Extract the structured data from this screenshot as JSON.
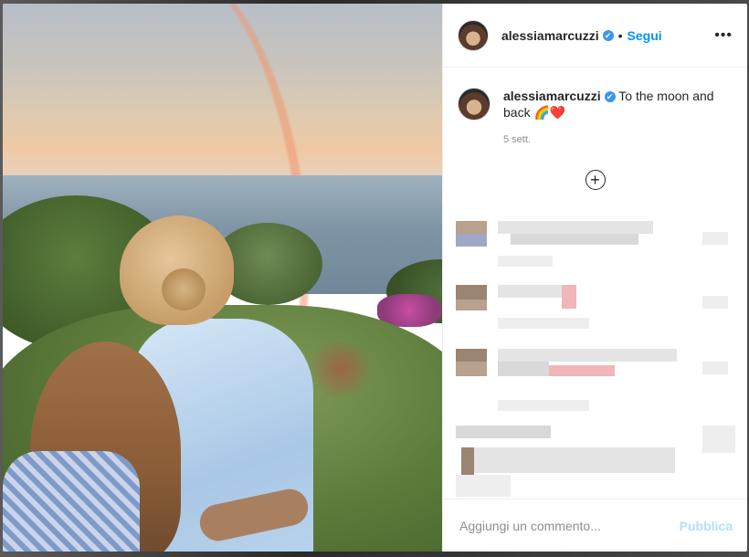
{
  "post": {
    "username": "alessiamarcuzzi",
    "follow_label": "Segui",
    "dot": "•",
    "verified_icon": "✔",
    "more_icon": "•••",
    "caption_text": "To the moon and back",
    "caption_emojis": "🌈❤️",
    "time": "5 sett.",
    "load_more_icon": "+"
  },
  "footer": {
    "comment_placeholder": "Aggiungi un commento...",
    "publish_label": "Pubblica"
  },
  "colors": {
    "accent": "#0095f6",
    "publish_disabled": "#b2dffc",
    "verified": "#3897f0"
  }
}
